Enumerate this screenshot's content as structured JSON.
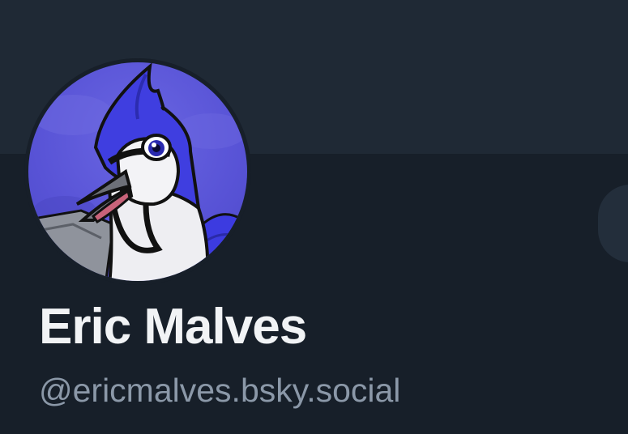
{
  "profile": {
    "display_name": "Eric Malves",
    "handle": "@ericmalves.bsky.social",
    "avatar_icon": "blue-jay-avatar"
  },
  "colors": {
    "background": "#171f29",
    "banner": "#1f2935",
    "name": "#f1f3f5",
    "handle": "#8b98a8",
    "avatar_sky": "#5a55d8",
    "bird_blue": "#3f3ee0"
  }
}
